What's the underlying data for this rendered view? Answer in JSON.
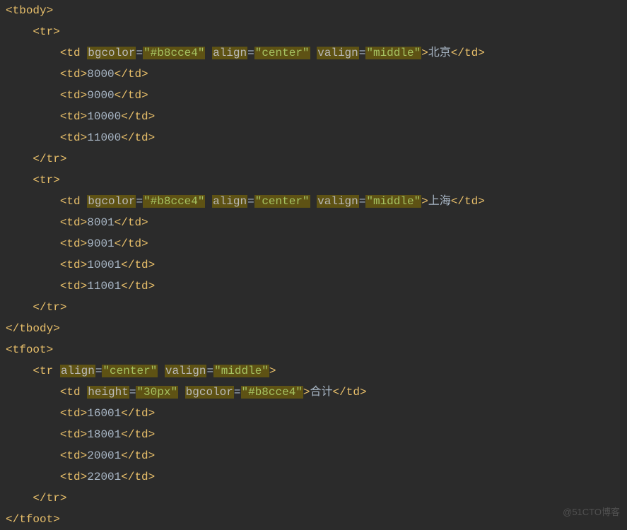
{
  "code": {
    "tbody_open": "tbody",
    "tbody_close": "tbody",
    "tr_open": "tr",
    "tr_close": "tr",
    "td_open": "td",
    "td_close": "td",
    "tfoot_open": "tfoot",
    "tfoot_close": "tfoot",
    "attr_bgcolor": "bgcolor",
    "attr_align": "align",
    "attr_valign": "valign",
    "attr_height": "height",
    "val_bgcolor": "\"#b8cce4\"",
    "val_center": "\"center\"",
    "val_middle": "\"middle\"",
    "val_height": "\"30px\"",
    "row1_city": "北京",
    "row1_vals": [
      "8000",
      "9000",
      "10000",
      "11000"
    ],
    "row2_city": "上海",
    "row2_vals": [
      "8001",
      "9001",
      "10001",
      "11001"
    ],
    "tfoot_label": "合计",
    "tfoot_vals": [
      "16001",
      "18001",
      "20001",
      "22001"
    ]
  },
  "watermark": "@51CTO博客"
}
